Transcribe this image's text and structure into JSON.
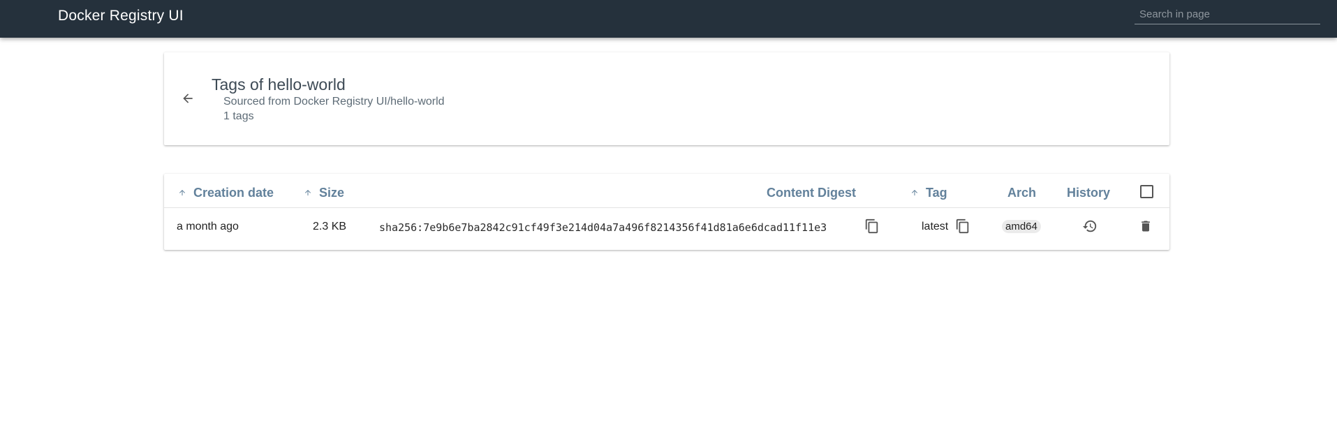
{
  "app": {
    "title": "Docker Registry UI",
    "search_placeholder": "Search in page"
  },
  "header": {
    "title": "Tags of hello-world",
    "subtitle": "Sourced from Docker Registry UI/hello-world",
    "count": "1 tags"
  },
  "table": {
    "columns": {
      "creation_date": "Creation date",
      "size": "Size",
      "content_digest": "Content Digest",
      "tag": "Tag",
      "arch": "Arch",
      "history": "History"
    },
    "rows": [
      {
        "creation_date": "a month ago",
        "size": "2.3 KB",
        "digest": "sha256:7e9b6e7ba2842c91cf49f3e214d04a7a496f8214356f41d81a6e6dcad11f11e3",
        "tag": "latest",
        "arch": "amd64"
      }
    ]
  },
  "icons": {
    "back": "arrow-back-icon",
    "sort": "arrow-up-icon",
    "copy": "copy-icon",
    "history": "history-icon",
    "delete": "delete-icon"
  },
  "colors": {
    "topbar": "#25313c",
    "header_text": "#62819b",
    "card_bg": "#ffffff"
  }
}
